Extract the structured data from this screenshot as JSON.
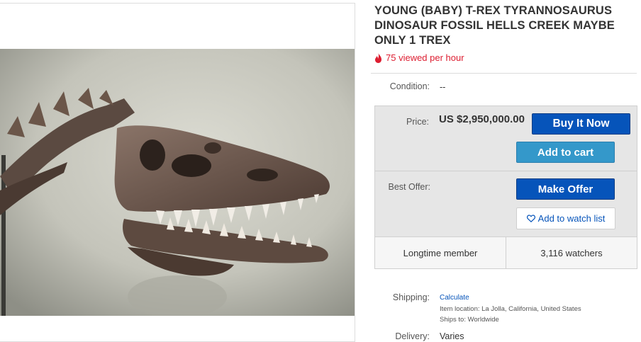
{
  "listing": {
    "title": "YOUNG (BABY) T-REX TYRANNOSAURUS DINOSAUR FOSSIL HELLS CREEK MAYBE ONLY 1 TREX",
    "views_text": "75 viewed per hour",
    "condition_label": "Condition:",
    "condition_value": "--",
    "price_label": "Price:",
    "price_value": "US $2,950,000.00",
    "best_offer_label": "Best Offer:",
    "shipping_label": "Shipping:",
    "shipping_value": "Calculate",
    "item_location": "Item location:  La Jolla, California, United States",
    "ships_to": "Ships to:  Worldwide",
    "delivery_label": "Delivery:",
    "delivery_value": "Varies"
  },
  "buttons": {
    "buy_now": "Buy It Now",
    "add_to_cart": "Add to cart",
    "make_offer": "Make Offer",
    "watch": "Add to watch list"
  },
  "stats": {
    "seller": "Longtime member",
    "watchers": "3,116 watchers"
  },
  "colors": {
    "primary_blue": "#0654ba",
    "cart_blue": "#3498ca",
    "hot_red": "#dd1e31"
  },
  "icons": {
    "views": "flame-icon",
    "watch": "heart-icon"
  }
}
